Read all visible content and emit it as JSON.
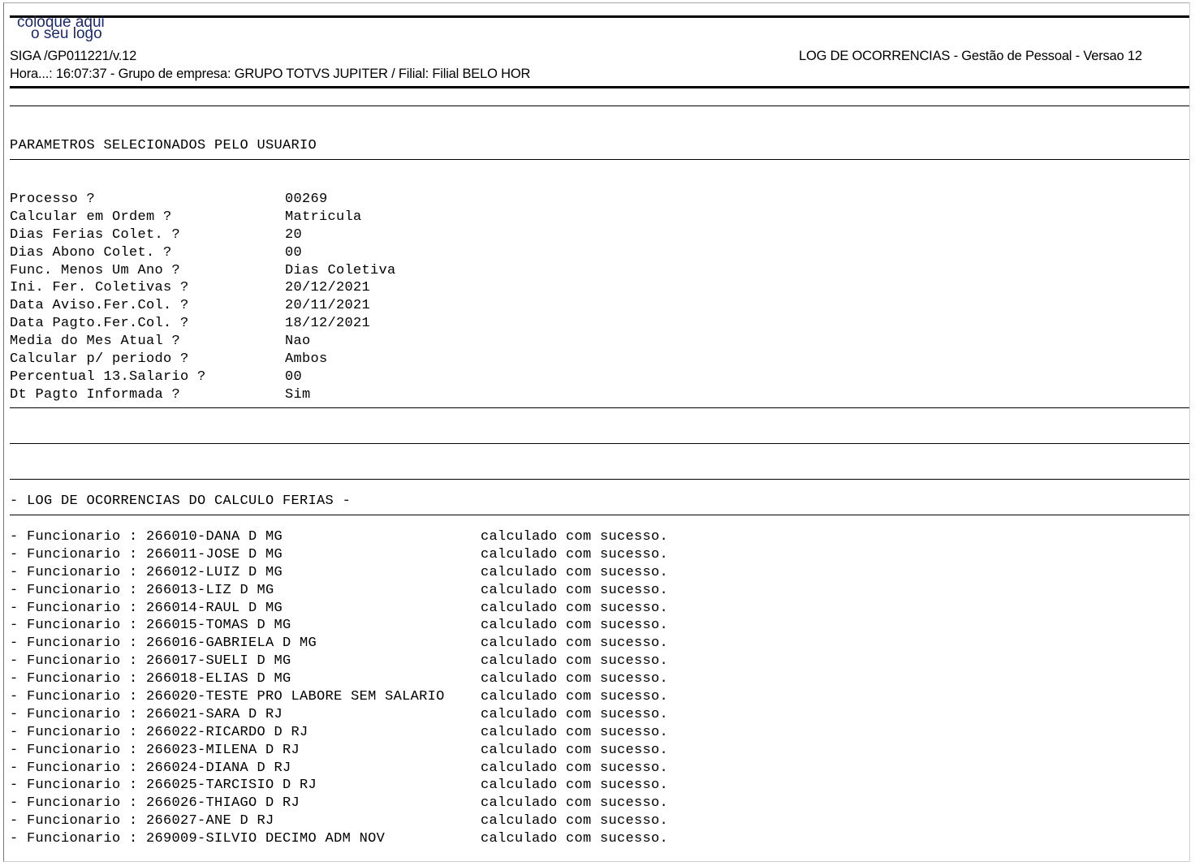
{
  "logo": {
    "line1": "coloque aqui",
    "line2": "o seu logo"
  },
  "header": {
    "program": "SIGA /GP011221/v.12",
    "title": "LOG DE OCORRENCIAS - Gestão de Pessoal - Versao 12",
    "info": "Hora...: 16:07:37 - Grupo de empresa: GRUPO TOTVS JUPITER / Filial: Filial BELO HOR"
  },
  "params_section": {
    "title": "PARAMETROS SELECIONADOS PELO USUARIO",
    "items": [
      {
        "label": "Processo ?",
        "value": "00269"
      },
      {
        "label": "Calcular em Ordem ?",
        "value": "Matricula"
      },
      {
        "label": "Dias Ferias Colet. ?",
        "value": "20"
      },
      {
        "label": "Dias Abono Colet. ?",
        "value": "00"
      },
      {
        "label": "Func. Menos Um Ano ?",
        "value": "Dias Coletiva"
      },
      {
        "label": "Ini. Fer. Coletivas ?",
        "value": "20/12/2021"
      },
      {
        "label": "Data Aviso.Fer.Col. ?",
        "value": "20/11/2021"
      },
      {
        "label": "Data Pagto.Fer.Col. ?",
        "value": "18/12/2021"
      },
      {
        "label": "Media do Mes Atual ?",
        "value": "Nao"
      },
      {
        "label": "Calcular p/ periodo ?",
        "value": "Ambos"
      },
      {
        "label": "Percentual 13.Salario ?",
        "value": "00"
      },
      {
        "label": "Dt Pagto Informada ?",
        "value": "Sim"
      }
    ]
  },
  "log_section": {
    "title": "- LOG DE OCORRENCIAS DO CALCULO FERIAS -",
    "entries": [
      {
        "employee": "- Funcionario : 266010-DANA D MG",
        "status": "calculado com sucesso."
      },
      {
        "employee": "- Funcionario : 266011-JOSE D MG",
        "status": "calculado com sucesso."
      },
      {
        "employee": "- Funcionario : 266012-LUIZ D MG",
        "status": "calculado com sucesso."
      },
      {
        "employee": "- Funcionario : 266013-LIZ D MG",
        "status": "calculado com sucesso."
      },
      {
        "employee": "- Funcionario : 266014-RAUL D MG",
        "status": "calculado com sucesso."
      },
      {
        "employee": "- Funcionario : 266015-TOMAS D MG",
        "status": "calculado com sucesso."
      },
      {
        "employee": "- Funcionario : 266016-GABRIELA D MG",
        "status": "calculado com sucesso."
      },
      {
        "employee": "- Funcionario : 266017-SUELI D MG",
        "status": "calculado com sucesso."
      },
      {
        "employee": "- Funcionario : 266018-ELIAS D MG",
        "status": "calculado com sucesso."
      },
      {
        "employee": "- Funcionario : 266020-TESTE PRO LABORE SEM SALARIO",
        "status": "calculado com sucesso."
      },
      {
        "employee": "- Funcionario : 266021-SARA D RJ",
        "status": "calculado com sucesso."
      },
      {
        "employee": "- Funcionario : 266022-RICARDO D RJ",
        "status": "calculado com sucesso."
      },
      {
        "employee": "- Funcionario : 266023-MILENA D RJ",
        "status": "calculado com sucesso."
      },
      {
        "employee": "- Funcionario : 266024-DIANA D RJ",
        "status": "calculado com sucesso."
      },
      {
        "employee": "- Funcionario : 266025-TARCISIO D RJ",
        "status": "calculado com sucesso."
      },
      {
        "employee": "- Funcionario : 266026-THIAGO D RJ",
        "status": "calculado com sucesso."
      },
      {
        "employee": "- Funcionario : 266027-ANE D RJ",
        "status": "calculado com sucesso."
      },
      {
        "employee": "- Funcionario : 269009-SILVIO DECIMO ADM NOV",
        "status": "calculado com sucesso."
      }
    ]
  }
}
